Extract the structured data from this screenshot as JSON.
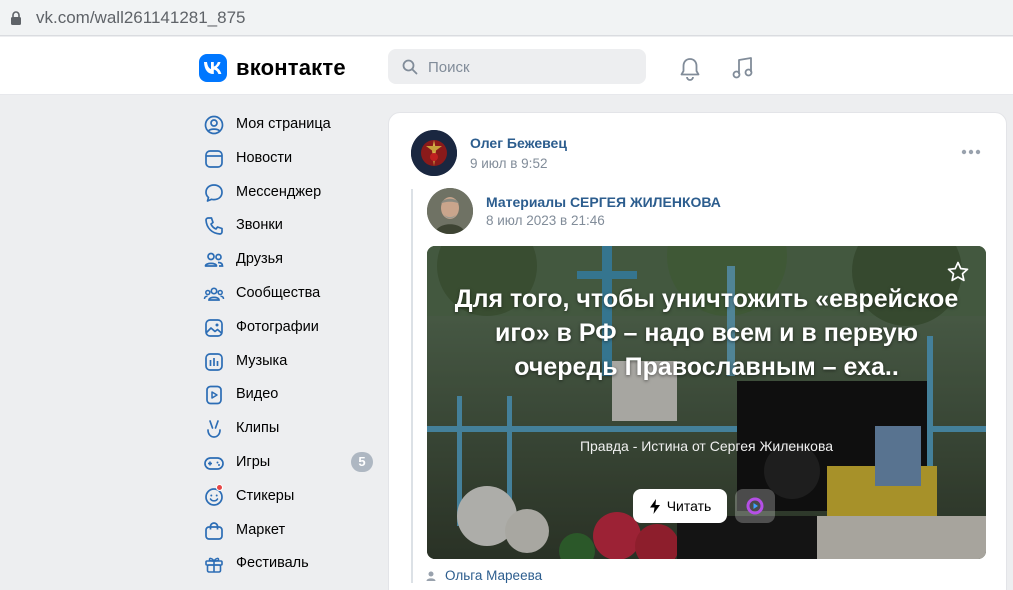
{
  "browser": {
    "url": "vk.com/wall261141281_875"
  },
  "header": {
    "logo_text": "вконтакте",
    "search_placeholder": "Поиск"
  },
  "sidebar": {
    "items": [
      {
        "label": "Моя страница",
        "icon": "user-icon"
      },
      {
        "label": "Новости",
        "icon": "news-icon"
      },
      {
        "label": "Мессенджер",
        "icon": "message-icon"
      },
      {
        "label": "Звонки",
        "icon": "phone-icon"
      },
      {
        "label": "Друзья",
        "icon": "friends-icon"
      },
      {
        "label": "Сообщества",
        "icon": "communities-icon"
      },
      {
        "label": "Фотографии",
        "icon": "photo-icon"
      },
      {
        "label": "Музыка",
        "icon": "music-icon"
      },
      {
        "label": "Видео",
        "icon": "video-icon"
      },
      {
        "label": "Клипы",
        "icon": "clips-icon"
      },
      {
        "label": "Игры",
        "icon": "games-icon",
        "badge": "5"
      },
      {
        "label": "Стикеры",
        "icon": "sticker-icon"
      },
      {
        "label": "Маркет",
        "icon": "market-icon"
      },
      {
        "label": "Фестиваль",
        "icon": "gift-icon"
      }
    ]
  },
  "post": {
    "author": "Олег Бежевец",
    "date": "9 июл в 9:52",
    "repost": {
      "author": "Материалы СЕРГЕЯ ЖИЛЕНКОВА",
      "date": "8 июл 2023 в 21:46",
      "article": {
        "title": "Для того, чтобы уничтожить «еврейское иго» в РФ – надо всем и в первую очередь Православным – еха..",
        "source": "Правда - Истина от Сергея Жиленкова",
        "read_label": "Читать"
      }
    },
    "signed_by": "Ольга Мареева"
  },
  "colors": {
    "accent": "#0077ff",
    "link": "#2c5d8e",
    "secondary": "#818c99"
  }
}
